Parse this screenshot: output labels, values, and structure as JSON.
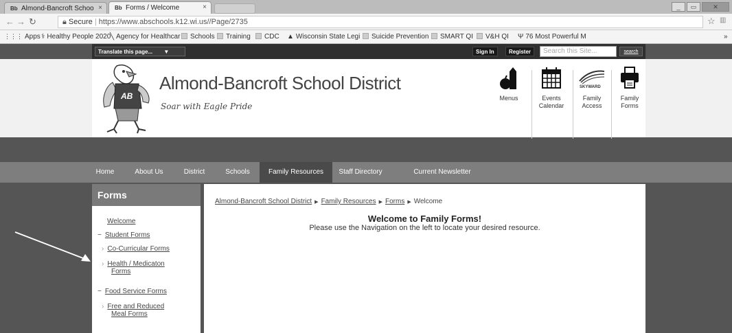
{
  "browser": {
    "tabs": [
      {
        "favicon": "Bb",
        "title": "Almond-Bancroft Schoo",
        "close": "×"
      },
      {
        "favicon": "Bb",
        "title": "Forms / Welcome",
        "close": "×"
      }
    ],
    "url_secure": "Secure",
    "url": "https://www.abschools.k12.wi.us//Page/2735",
    "bookmarks": [
      {
        "label": "Apps"
      },
      {
        "label": "Healthy People 2020"
      },
      {
        "label": "Agency for Healthcar"
      },
      {
        "label": "Schools"
      },
      {
        "label": "Training"
      },
      {
        "label": "CDC"
      },
      {
        "label": "Wisconsin State Legi"
      },
      {
        "label": "Suicide Prevention"
      },
      {
        "label": "SMART QI"
      },
      {
        "label": "V&H QI"
      },
      {
        "label": "76 Most Powerful M"
      }
    ],
    "more": "»",
    "star": "☆"
  },
  "topbar": {
    "translate": "Translate this page...",
    "signin": "Sign In",
    "register": "Register",
    "search_placeholder": "Search this Site...",
    "search_button": "search"
  },
  "header": {
    "logo_letters": "AB",
    "title": "Almond-Bancroft School District",
    "tagline": "Soar with Eagle Pride",
    "quicklinks": [
      {
        "label": "Menus",
        "icon": "apple-milk-icon"
      },
      {
        "label": "Events Calendar",
        "icon": "calendar-icon"
      },
      {
        "label": "Family Access",
        "icon": "skyward-icon",
        "text": "SKYWARD"
      },
      {
        "label": "Family Forms",
        "icon": "printer-icon"
      }
    ]
  },
  "nav": [
    {
      "label": "Home"
    },
    {
      "label": "About Us"
    },
    {
      "label": "District"
    },
    {
      "label": "Schools"
    },
    {
      "label": "Family Resources",
      "active": true
    },
    {
      "label": "Staff Directory"
    },
    {
      "label": "Current Newsletter"
    }
  ],
  "sidebar": {
    "heading": "Forms",
    "items": [
      {
        "label": "Welcome"
      },
      {
        "label": "Student Forms",
        "bullet": "−"
      },
      {
        "label": "Co-Curricular Forms",
        "bullet": "›"
      },
      {
        "label": "Health / Medicaton",
        "bullet": "›"
      },
      {
        "label": "Forms"
      },
      {
        "label": "Food Service Forms",
        "bullet": "−"
      },
      {
        "label": "Free and Reduced",
        "bullet": "›"
      },
      {
        "label": "Meal Forms"
      }
    ]
  },
  "content": {
    "breadcrumb": [
      "Almond-Bancroft School District",
      "Family Resources",
      "Forms",
      "Welcome"
    ],
    "crumb_sep": "▶",
    "heading": "Welcome to Family Forms!",
    "instructions": "Please use the Navigation on the left to locate your desired resource."
  },
  "colors": {
    "nav_bar": "#7e7e7e",
    "nav_active": "#4a4a4a",
    "page_bg": "#555555",
    "top_bar": "#2f2f2f"
  }
}
